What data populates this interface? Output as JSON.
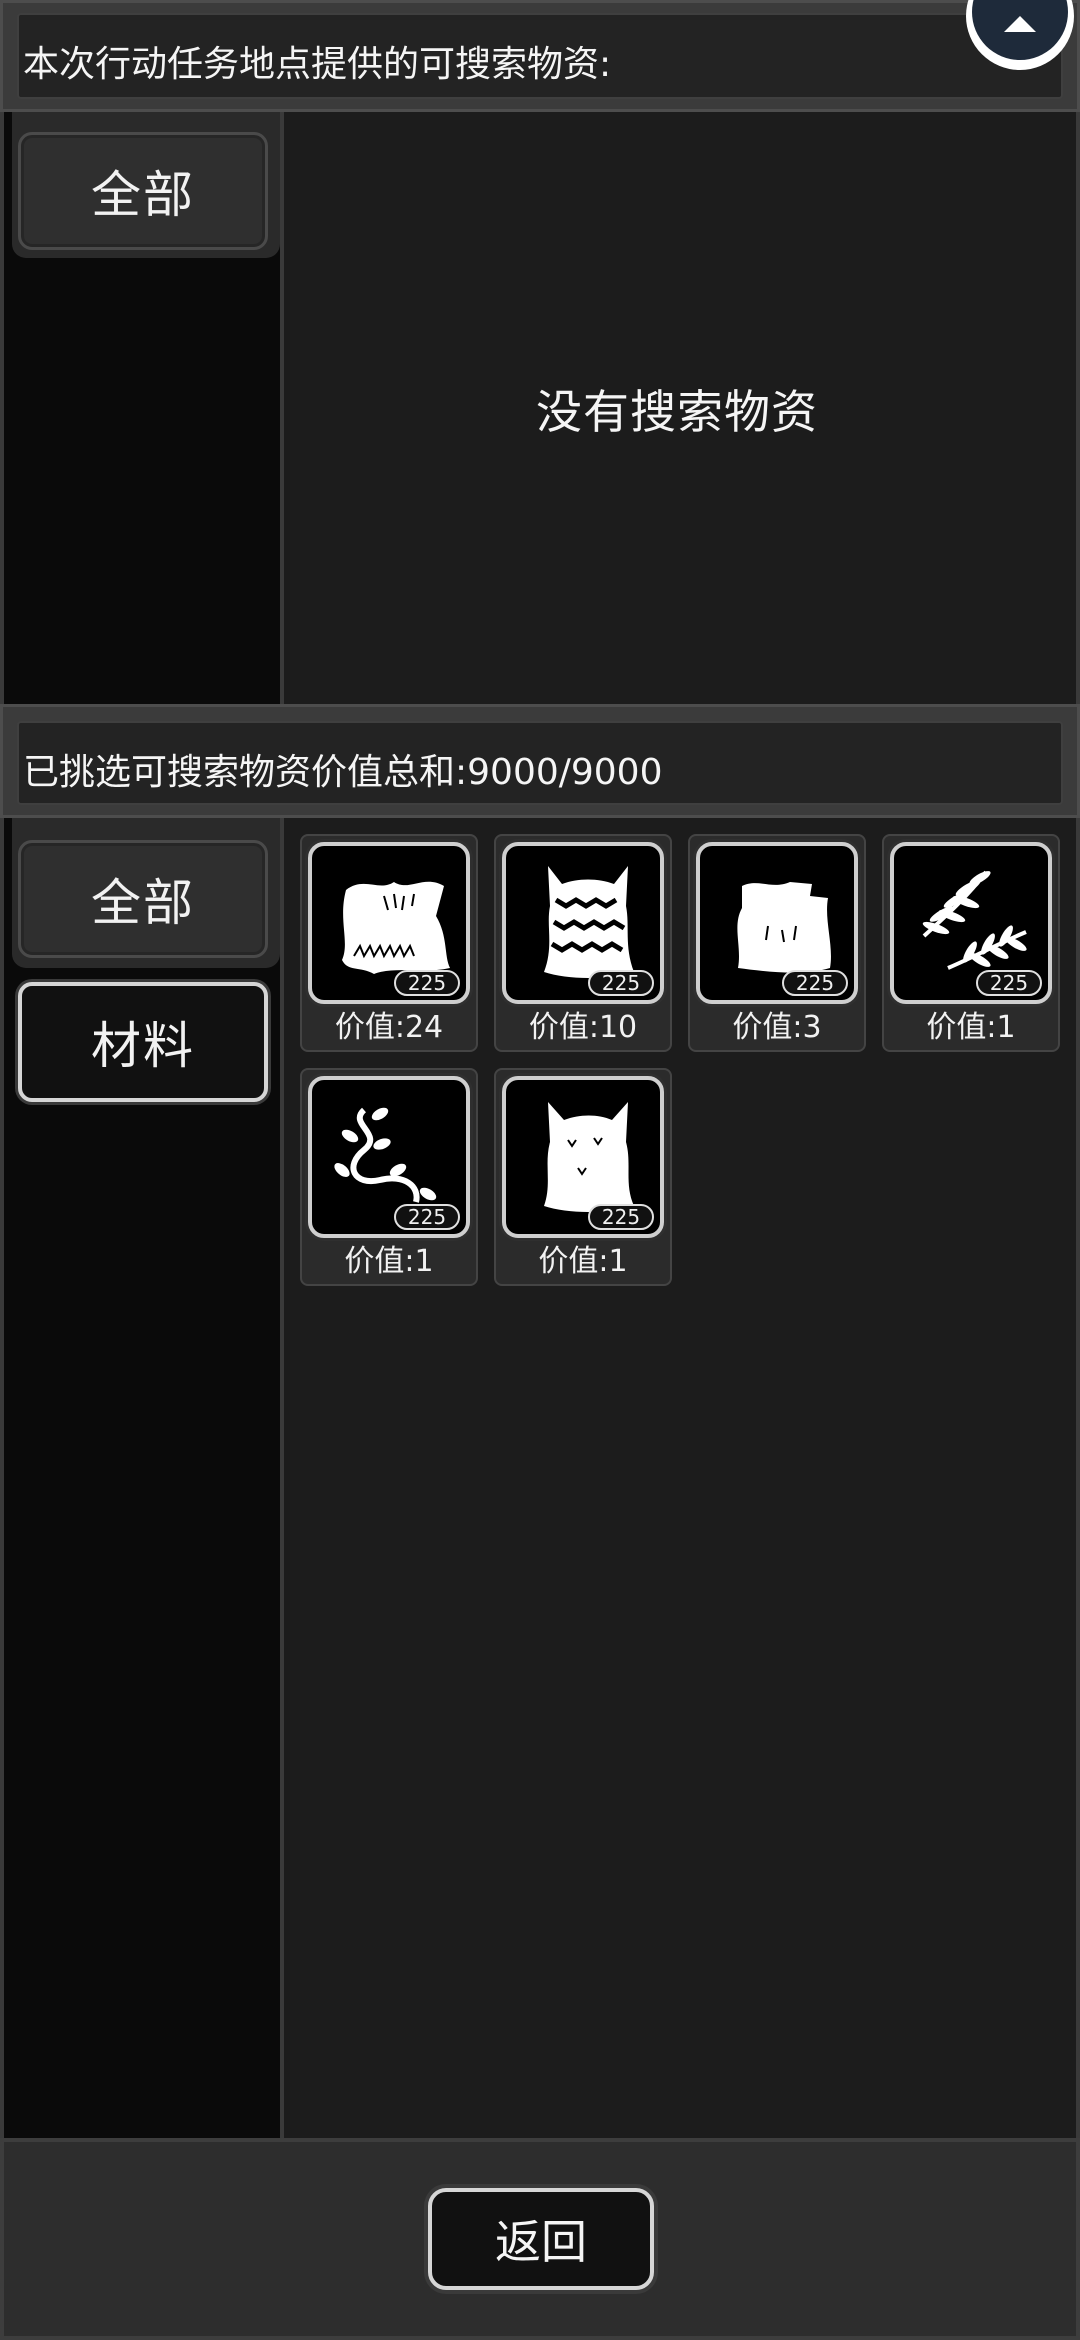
{
  "top_section": {
    "header": "本次行动任务地点提供的可搜索物资:",
    "tabs": [
      {
        "label": "全部",
        "active": true
      }
    ],
    "empty_message": "没有搜索物资"
  },
  "bottom_section": {
    "header": "已挑选可搜索物资价值总和:9000/9000",
    "tabs": [
      {
        "label": "全部",
        "active": true
      },
      {
        "label": "材料",
        "active": false
      }
    ],
    "items": [
      {
        "icon": "fur-pelt-icon",
        "badge": "225",
        "value_label": "价值:24"
      },
      {
        "icon": "striped-pelt-icon",
        "badge": "225",
        "value_label": "价值:10"
      },
      {
        "icon": "hide-icon",
        "badge": "225",
        "value_label": "价值:3"
      },
      {
        "icon": "fern-leaf-icon",
        "badge": "225",
        "value_label": "价值:1"
      },
      {
        "icon": "vine-icon",
        "badge": "225",
        "value_label": "价值:1"
      },
      {
        "icon": "white-pelt-icon",
        "badge": "225",
        "value_label": "价值:1"
      }
    ]
  },
  "footer": {
    "back_label": "返回"
  },
  "colors": {
    "background": "#1a1a1a",
    "panel_left": "#0a0a0a",
    "button_border": "#d6d6d6"
  }
}
